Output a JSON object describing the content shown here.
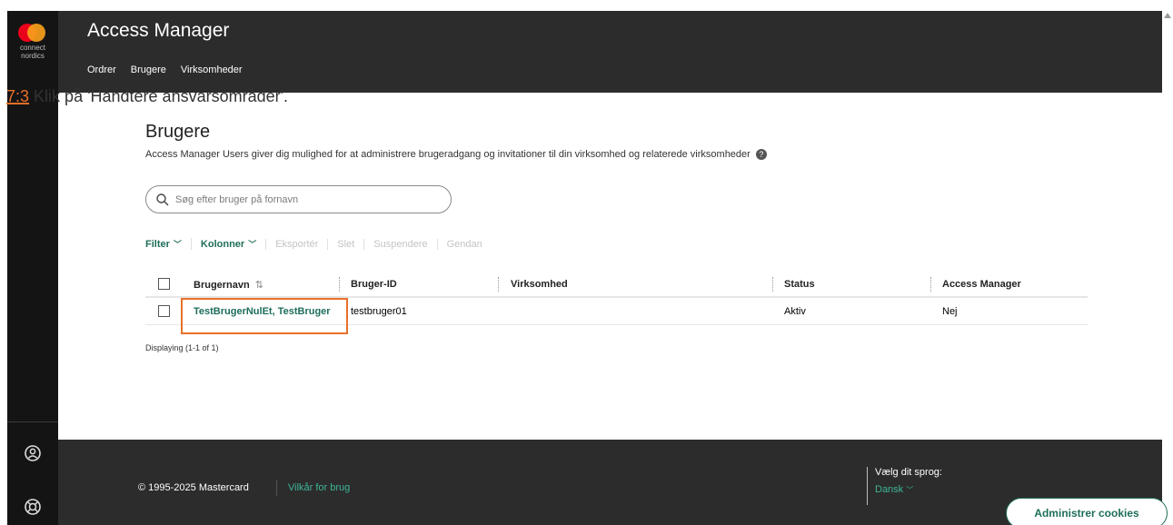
{
  "app": {
    "logo_text_line1": "connect",
    "logo_text_line2": "nordics",
    "title": "Access Manager"
  },
  "nav": {
    "items": [
      "Ordrer",
      "Brugere",
      "Virksomheder"
    ]
  },
  "step": {
    "number": "7:3",
    "instruction": "Klik på 'Håndtere ansvarsområder'."
  },
  "page": {
    "title": "Brugere",
    "description": "Access Manager Users giver dig mulighed for at administrere brugeradgang og invitationer til din virksomhed og relaterede virksomheder",
    "help_icon_glyph": "?"
  },
  "search": {
    "placeholder": "Søg efter bruger på fornavn"
  },
  "toolbar": {
    "filter": "Filter",
    "columns": "Kolonner",
    "export": "Eksportér",
    "delete": "Slet",
    "suspend": "Suspendere",
    "restore": "Gendan"
  },
  "table": {
    "headers": {
      "name": "Brugernavn",
      "id": "Bruger-ID",
      "company": "Virksomhed",
      "status": "Status",
      "access_manager": "Access Manager"
    },
    "sort_glyph": "⇅",
    "rows": [
      {
        "name": "TestBrugerNulEt, TestBruger",
        "id": "testbruger01",
        "company": "",
        "status": "Aktiv",
        "access_manager": "Nej"
      }
    ],
    "displaying": "Displaying (1-1 of 1)"
  },
  "footer": {
    "copyright": "© 1995-2025 Mastercard",
    "terms": "Vilkår for brug",
    "language_label": "Vælg dit sprog:",
    "language_value": "Dansk",
    "cookies_button": "Administrer cookies"
  },
  "colors": {
    "accent_green": "#1e6e5a",
    "highlight_orange": "#e8702a",
    "header_bg": "#2c2c2c",
    "sidebar_bg": "#141414"
  }
}
